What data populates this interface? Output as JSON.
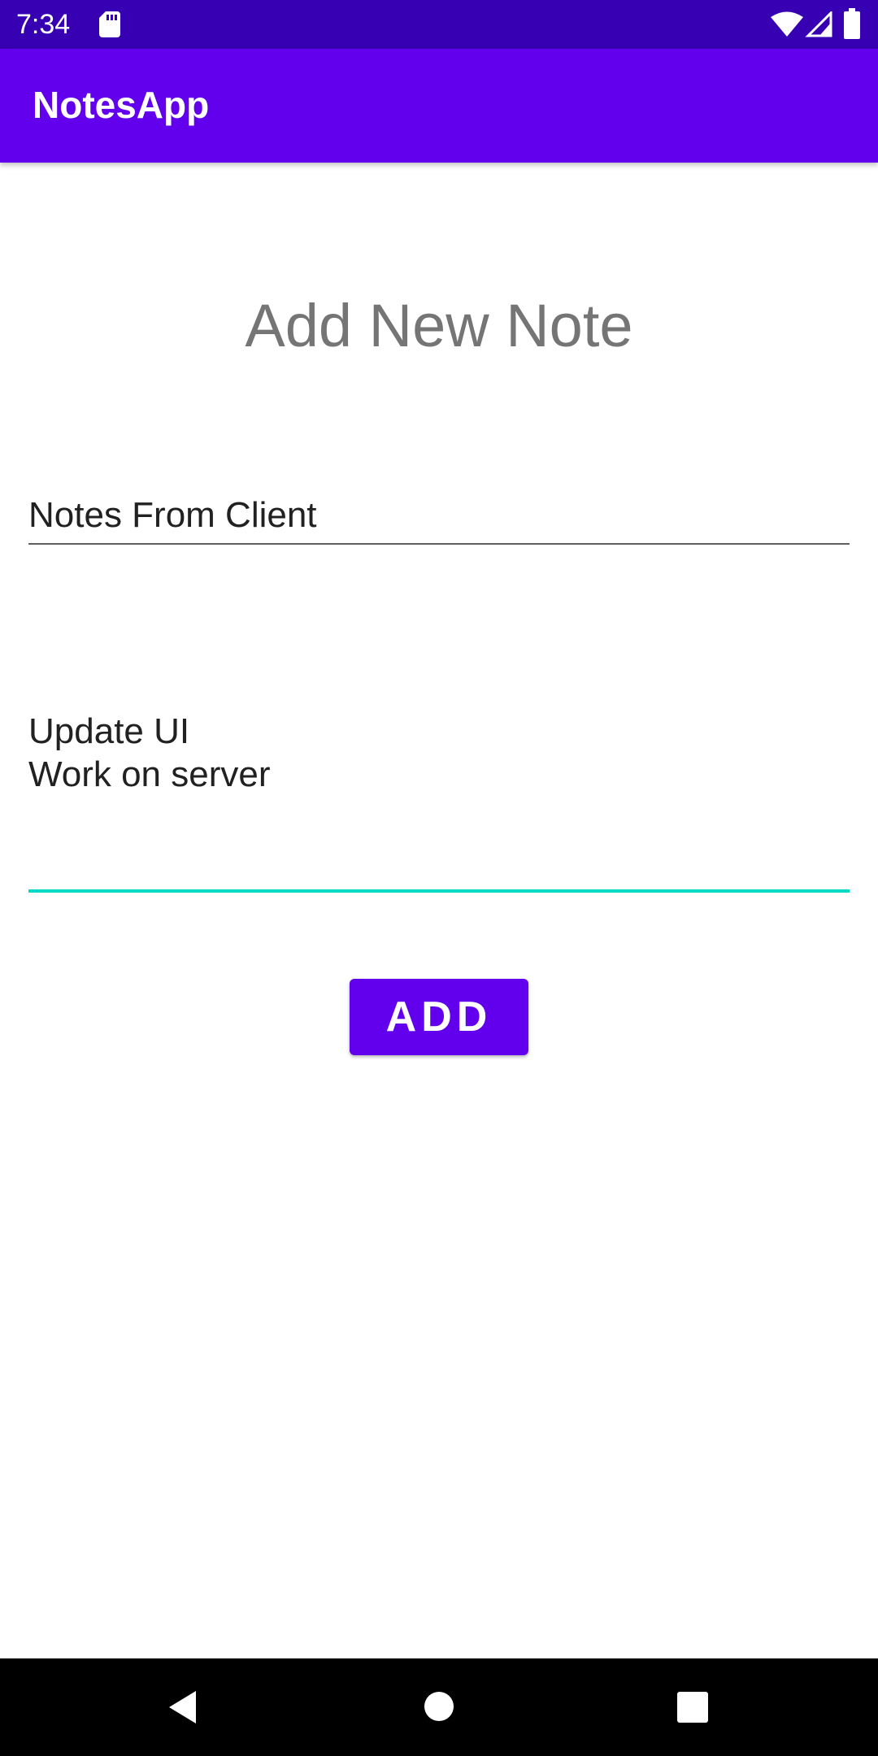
{
  "status_bar": {
    "time": "7:34",
    "icons": [
      "sd-card-icon",
      "wifi-icon",
      "signal-icon",
      "battery-icon"
    ],
    "background_color": "#3700b3"
  },
  "app_bar": {
    "title": "NotesApp",
    "background_color": "#6200ee"
  },
  "form": {
    "heading": "Add New Note",
    "title_field": {
      "value": "Notes From Client"
    },
    "body_field": {
      "lines": [
        "Update UI",
        "Work on server"
      ],
      "focused_underline_color": "#03dac5"
    },
    "add_button": {
      "label": "ADD",
      "color": "#6200ee"
    }
  },
  "nav_bar": {
    "icons": [
      "back-icon",
      "home-icon",
      "recents-icon"
    ]
  }
}
